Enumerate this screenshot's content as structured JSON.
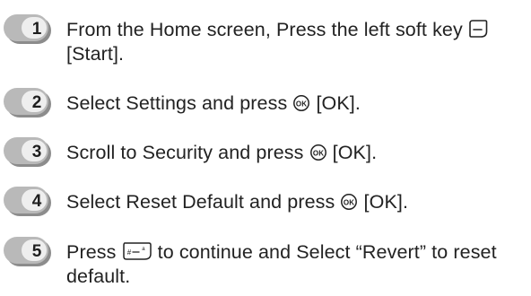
{
  "steps": [
    {
      "number": "1",
      "before": "From the Home screen, Press the left soft key",
      "icon": "left-soft-key-icon",
      "after": "[Start]."
    },
    {
      "number": "2",
      "before": "Select Settings and press",
      "icon": "ok-key-icon",
      "after": "[OK]."
    },
    {
      "number": "3",
      "before": "Scroll to Security and press",
      "icon": "ok-key-icon",
      "after": "[OK]."
    },
    {
      "number": "4",
      "before": "Select Reset Default and press",
      "icon": "ok-key-icon",
      "after": "[OK]."
    },
    {
      "number": "5",
      "before": "Press",
      "icon": "right-soft-key-icon",
      "after": "to continue and Select “Revert” to reset default."
    }
  ],
  "colors": {
    "badge_fill": "#b9b9b9",
    "badge_shadow": "#8c8c8c",
    "badge_inner": "#eeeeee",
    "text": "#222222"
  }
}
